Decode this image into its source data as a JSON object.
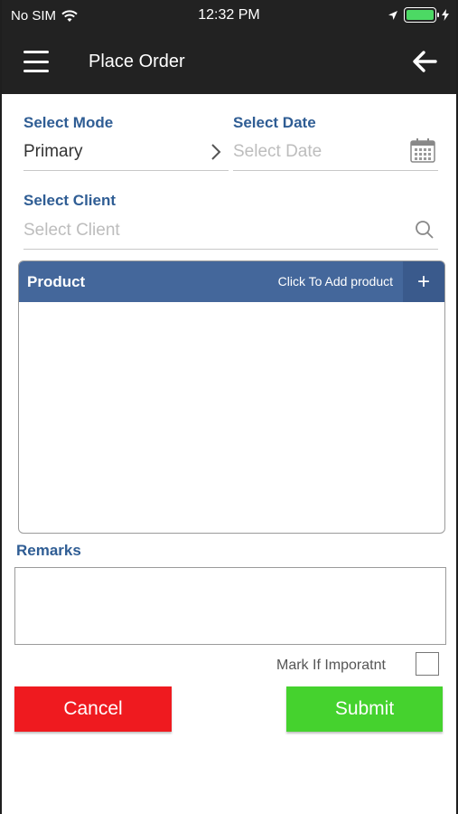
{
  "status_bar": {
    "carrier": "No SIM",
    "time": "12:32 PM"
  },
  "header": {
    "title": "Place Order"
  },
  "form": {
    "mode_label": "Select Mode",
    "mode_value": "Primary",
    "date_label": "Select Date",
    "date_placeholder": "Select Date",
    "client_label": "Select Client",
    "client_placeholder": "Select Client"
  },
  "product": {
    "title": "Product",
    "hint": "Click To Add product",
    "add": "+"
  },
  "remarks": {
    "label": "Remarks"
  },
  "mark": {
    "label": "Mark If Imporatnt"
  },
  "actions": {
    "cancel": "Cancel",
    "submit": "Submit"
  },
  "colors": {
    "header_bg": "#222222",
    "label_blue": "#2f5d94",
    "product_bar": "#44679b",
    "cancel_red": "#ef1a1f",
    "submit_green": "#45d22e"
  }
}
